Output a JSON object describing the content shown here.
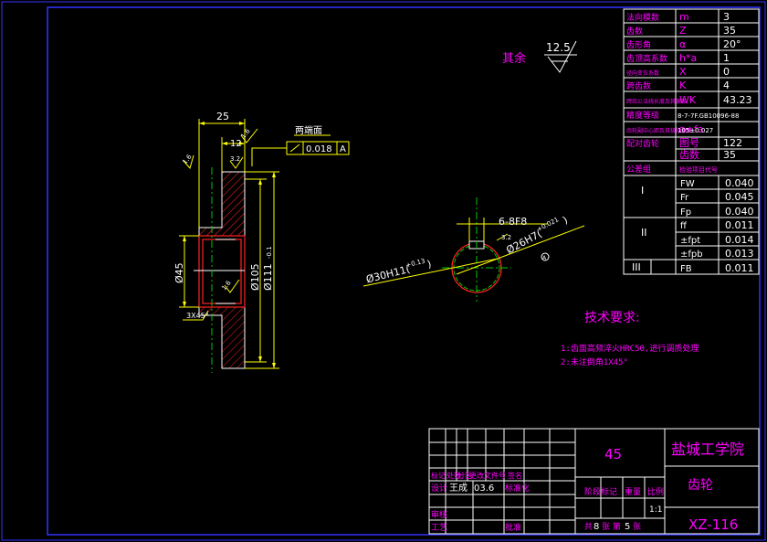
{
  "colors": {
    "background": "#000000",
    "border": "#3333ff",
    "outline": "#ffffff",
    "dimension": "#ffff00",
    "section_edge": "#ff0000",
    "hatch": "#ff0000",
    "centerline": "#00cc00",
    "label": "#ff00ff"
  },
  "surface_finish": {
    "label": "其余",
    "value": "12.5"
  },
  "params": [
    {
      "name": "法向模数",
      "symbol": "m",
      "value": "3"
    },
    {
      "name": "齿数",
      "symbol": "Z",
      "value": "35"
    },
    {
      "name": "齿形角",
      "symbol": "α",
      "value": "20°"
    },
    {
      "name": "齿顶高系数",
      "symbol": "h*a",
      "value": "1"
    },
    {
      "name": "径向变位系数",
      "symbol": "X",
      "value": "0"
    },
    {
      "name": "跨齿数",
      "symbol": "K",
      "value": "4"
    },
    {
      "name": "跨齿公法线长度及其偏差",
      "symbol": "WK",
      "value": "43.23"
    },
    {
      "name": "精度等级",
      "symbol": "",
      "value": "8-7-7F.GB10096-88"
    },
    {
      "name": "齿轮副中心距及其极限偏差",
      "symbol": "a±fa",
      "value": "105±0.027"
    },
    {
      "name": "配对齿轮",
      "symbol": "图号",
      "value": "122"
    },
    {
      "name": "",
      "symbol": "齿数",
      "value": "35"
    },
    {
      "name": "公差组",
      "symbol": "检验项目代号",
      "value": ""
    }
  ],
  "tolerance_groups": [
    {
      "group": "I",
      "items": [
        {
          "code": "FW",
          "value": "0.040"
        },
        {
          "code": "Fr",
          "value": "0.045"
        },
        {
          "code": "Fp",
          "value": "0.040"
        }
      ]
    },
    {
      "group": "II",
      "items": [
        {
          "code": "ff",
          "value": "0.011"
        },
        {
          "code": "±fpt",
          "value": "0.014"
        },
        {
          "code": "±fpb",
          "value": "0.013"
        }
      ]
    },
    {
      "group": "III",
      "items": [
        {
          "code": "FB",
          "value": "0.011"
        }
      ]
    }
  ],
  "tech_req": {
    "title": "技术要求:",
    "items": [
      "1:齿面高频淬火HRC50,进行调质处理",
      "2:未注倒角1X45°"
    ]
  },
  "dims": {
    "width_25": "25",
    "width_12": "12",
    "rough_top": "1.6",
    "rough_small": "3.2",
    "rough_left": "1.6",
    "both_ends": "两端面",
    "runout_value": "0.018",
    "datum": "A",
    "dia_45": "Ø45",
    "dia_105": "Ø105",
    "dia_111": "Ø111",
    "dia_111_tol": "-0.1",
    "chamfer": "3X45°",
    "rough_bore": "1.6",
    "keyway": "6-8F8",
    "keyway_rough": "3.2",
    "keyway_depth": "Ø26H7(",
    "keyway_depth_tol": "+0.021",
    "keyway_depth_close": ")",
    "bore": "Ø30H11(",
    "bore_tol": "+0.13",
    "bore_close": ")",
    "datum_mark": "A"
  },
  "title_block": {
    "material": "45",
    "school": "盐城工学院",
    "part_name": "齿轮",
    "drawing_no": "XZ-116",
    "scale": "1:1",
    "row_labels": [
      "标记",
      "处数",
      "分区",
      "更改文件号",
      "签名"
    ],
    "designer_label": "设计",
    "designer": "王成",
    "date": "03.6",
    "std_label": "标准化",
    "audit_label": "审核",
    "process_label": "工艺",
    "approve_label": "批准",
    "stage_label": "阶段标记",
    "weight_label": "重量",
    "scale_label": "比例",
    "sheets_label": "共",
    "sheets_total": "8",
    "sheet_label_mid": "张 第",
    "sheet_no": "5",
    "sheet_label_end": "张"
  }
}
